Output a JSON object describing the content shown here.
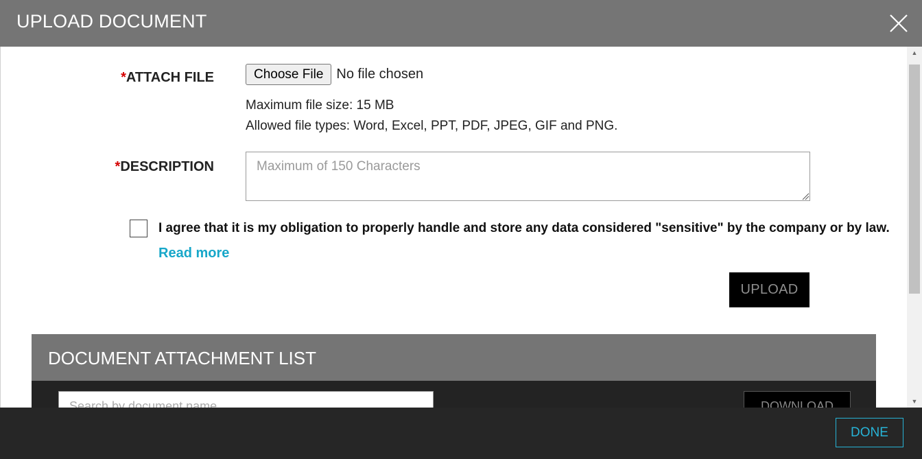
{
  "header": {
    "title": "UPLOAD DOCUMENT",
    "close_icon": "close-icon"
  },
  "form": {
    "attach": {
      "required_mark": "*",
      "label": "ATTACH FILE",
      "choose_button": "Choose File",
      "no_file_text": "No file chosen",
      "max_size": "Maximum file size: 15 MB",
      "allowed_types": "Allowed file types: Word, Excel, PPT, PDF, JPEG, GIF and PNG."
    },
    "description": {
      "required_mark": "*",
      "label": "DESCRIPTION",
      "value": "",
      "placeholder": "Maximum of 150 Characters"
    },
    "agreement": {
      "checked": false,
      "text": "I agree that it is my obligation to properly handle and store any data considered \"sensitive\" by the company or by law.",
      "read_more": "Read more"
    },
    "upload_button": "UPLOAD"
  },
  "attachment_list": {
    "title": "DOCUMENT ATTACHMENT LIST",
    "search_placeholder": "Search by document name",
    "download_button": "DOWNLOAD"
  },
  "footer": {
    "done_button": "DONE"
  },
  "colors": {
    "header_bg": "#757575",
    "footer_bg": "#262626",
    "required": "#d40000",
    "link": "#17a7c9",
    "done_accent": "#27b3d6",
    "upload_bg": "#000000"
  }
}
